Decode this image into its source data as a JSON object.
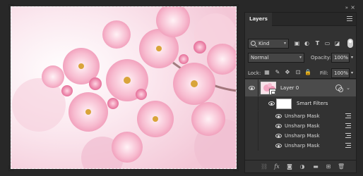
{
  "panel": {
    "tab_label": "Layers",
    "kind_label": "Kind",
    "blend_mode": "Normal",
    "opacity_label": "Opacity:",
    "opacity_value": "100%",
    "lock_label": "Lock:",
    "fill_label": "Fill:",
    "fill_value": "100%"
  },
  "layers": {
    "layer0_name": "Layer 0",
    "smart_filters_label": "Smart Filters",
    "filters": [
      "Unsharp Mask",
      "Unsharp Mask",
      "Unsharp Mask",
      "Unsharp Mask"
    ]
  },
  "icons": {
    "filter_icons": [
      "image-icon",
      "adjustment-icon",
      "type-icon",
      "shape-icon",
      "smart-object-icon"
    ],
    "lock_icons": [
      "lock-transparent-icon",
      "lock-paint-icon",
      "lock-move-icon",
      "lock-artboard-icon",
      "lock-all-icon"
    ],
    "footer_icons": [
      "link-icon",
      "fx-icon",
      "mask-icon",
      "adjustment-icon",
      "group-icon",
      "new-layer-icon",
      "trash-icon"
    ]
  },
  "colors": {
    "panel_bg": "#323232",
    "selected_row": "#4b4b4b",
    "app_bg": "#282828"
  }
}
